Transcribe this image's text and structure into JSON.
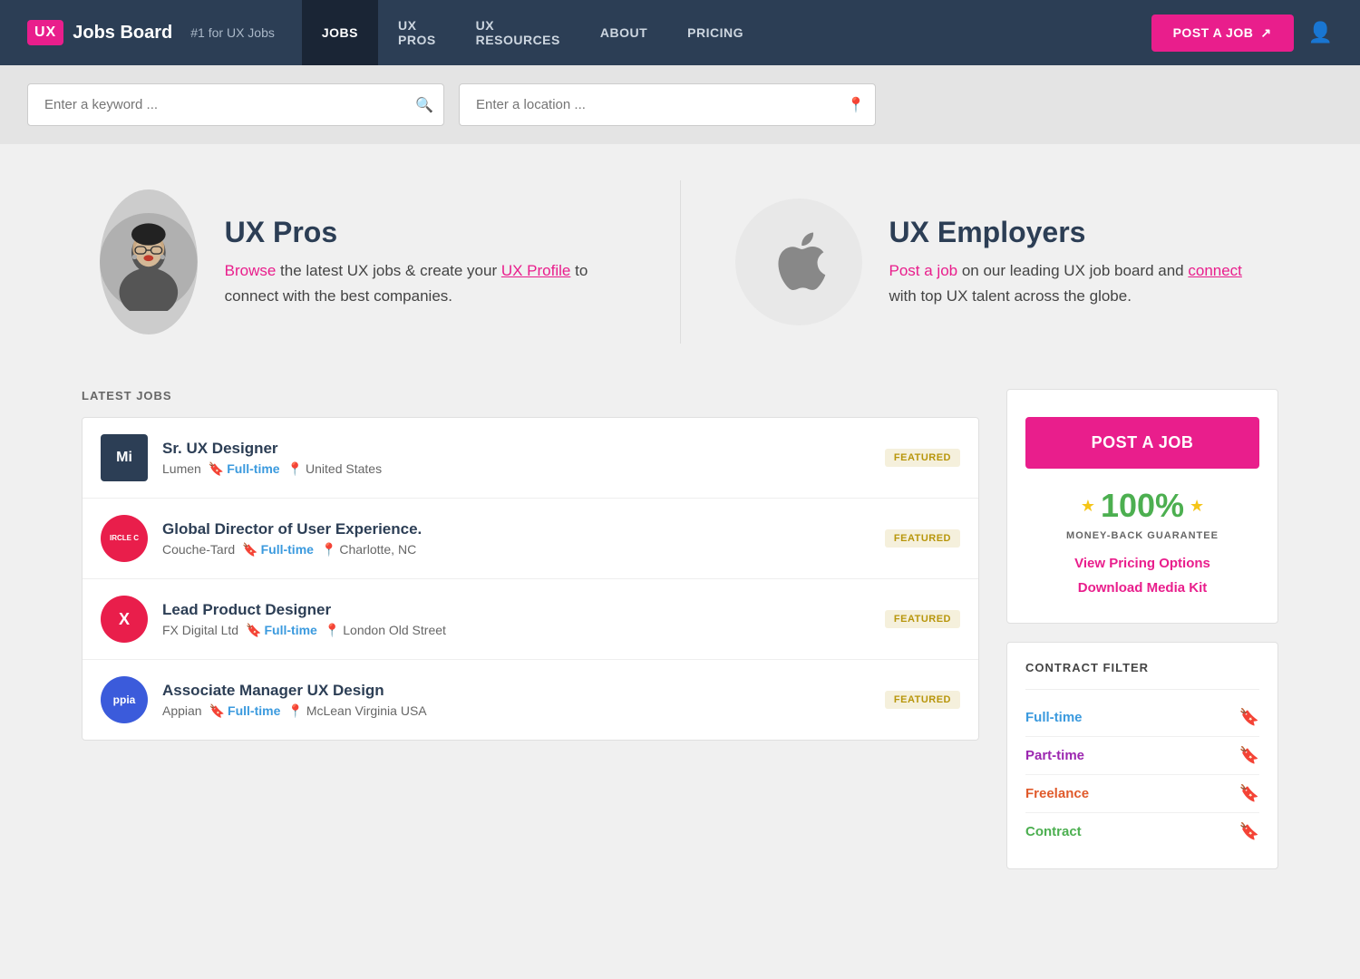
{
  "nav": {
    "logo_text": "UX",
    "brand_name": "Jobs Board",
    "tagline": "#1 for UX Jobs",
    "links": [
      {
        "label": "JOBS",
        "active": true
      },
      {
        "label": "UX PROS",
        "active": false
      },
      {
        "label": "UX RESOURCES",
        "active": false
      },
      {
        "label": "ABOUT",
        "active": false
      },
      {
        "label": "PRICING",
        "active": false
      }
    ],
    "post_job_btn": "POST A JOB"
  },
  "search": {
    "keyword_placeholder": "Enter a keyword ...",
    "location_placeholder": "Enter a location ..."
  },
  "hero": {
    "ux_pros_title": "UX Pros",
    "ux_pros_browse": "Browse",
    "ux_pros_text1": " the latest UX jobs & create your ",
    "ux_pros_profile": "UX Profile",
    "ux_pros_text2": " to connect with the best companies.",
    "ux_employers_title": "UX Employers",
    "ux_employers_post": "Post a job",
    "ux_employers_text1": " on our leading UX job board and ",
    "ux_employers_connect": "connect",
    "ux_employers_text2": " with top UX talent across the globe."
  },
  "jobs_section": {
    "heading": "LATEST JOBS",
    "jobs": [
      {
        "logo_text": "Mi",
        "logo_class": "job-logo-mi",
        "title": "Sr. UX Designer",
        "company": "Lumen",
        "type": "Full-time",
        "location": "United States",
        "featured": "FEATURED"
      },
      {
        "logo_text": "CIRCLE C",
        "logo_class": "job-logo-circle",
        "title": "Global Director of User Experience.",
        "company": "Couche-Tard",
        "type": "Full-time",
        "location": "Charlotte, NC",
        "featured": "FEATURED"
      },
      {
        "logo_text": "X",
        "logo_class": "job-logo-x",
        "title": "Lead Product Designer",
        "company": "FX Digital Ltd",
        "type": "Full-time",
        "location": "London Old Street",
        "featured": "FEATURED"
      },
      {
        "logo_text": "ppia",
        "logo_class": "job-logo-appian",
        "title": "Associate Manager UX Design",
        "company": "Appian",
        "type": "Full-time",
        "location": "McLean Virginia USA",
        "featured": "FEATURED"
      }
    ]
  },
  "sidebar": {
    "post_job_btn": "POST A JOB",
    "guarantee_pct": "100%",
    "guarantee_label": "MONEY-BACK GUARANTEE",
    "pricing_link": "View Pricing Options",
    "media_link": "Download Media Kit",
    "contract_filter_heading": "CONTRACT FILTER",
    "filters": [
      {
        "label": "Full-time",
        "class": "filter-label-fulltime",
        "bookmark_class": "filter-bookmark-blue"
      },
      {
        "label": "Part-time",
        "class": "filter-label-parttime",
        "bookmark_class": "filter-bookmark-purple"
      },
      {
        "label": "Freelance",
        "class": "filter-label-freelance",
        "bookmark_class": "filter-bookmark-orange"
      },
      {
        "label": "Contract",
        "class": "filter-label-contract",
        "bookmark_class": "filter-bookmark-green"
      }
    ]
  }
}
